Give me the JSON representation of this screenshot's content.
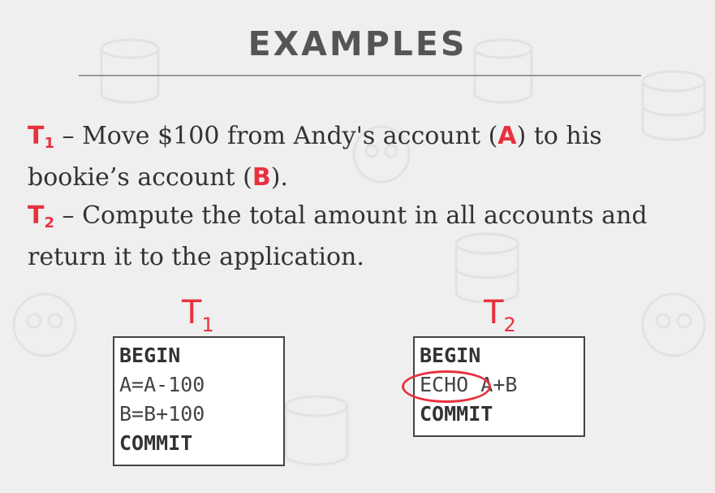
{
  "slide": {
    "title": "EXAMPLES"
  },
  "t1_desc": {
    "txn_letter": "T",
    "txn_sub": "1",
    "text_a": " – Move $100 from Andy's account (",
    "acct_a": "A",
    "text_b": ") to his bookie’s account (",
    "acct_b": "B",
    "text_c": ")."
  },
  "t2_desc": {
    "txn_letter": "T",
    "txn_sub": "2",
    "text": " – Compute the total amount in all accounts and return it to the application."
  },
  "transactions": [
    {
      "label_letter": "T",
      "label_sub": "1",
      "lines": [
        "BEGIN",
        "A=A-100",
        "B=B+100",
        "COMMIT"
      ]
    },
    {
      "label_letter": "T",
      "label_sub": "2",
      "begin": "BEGIN",
      "echo": "ECHO",
      "echo_arg": " A+B",
      "commit": "COMMIT"
    }
  ],
  "colors": {
    "accent": "#e8313f",
    "title": "#555555",
    "text": "#333333",
    "background": "#efefef"
  }
}
